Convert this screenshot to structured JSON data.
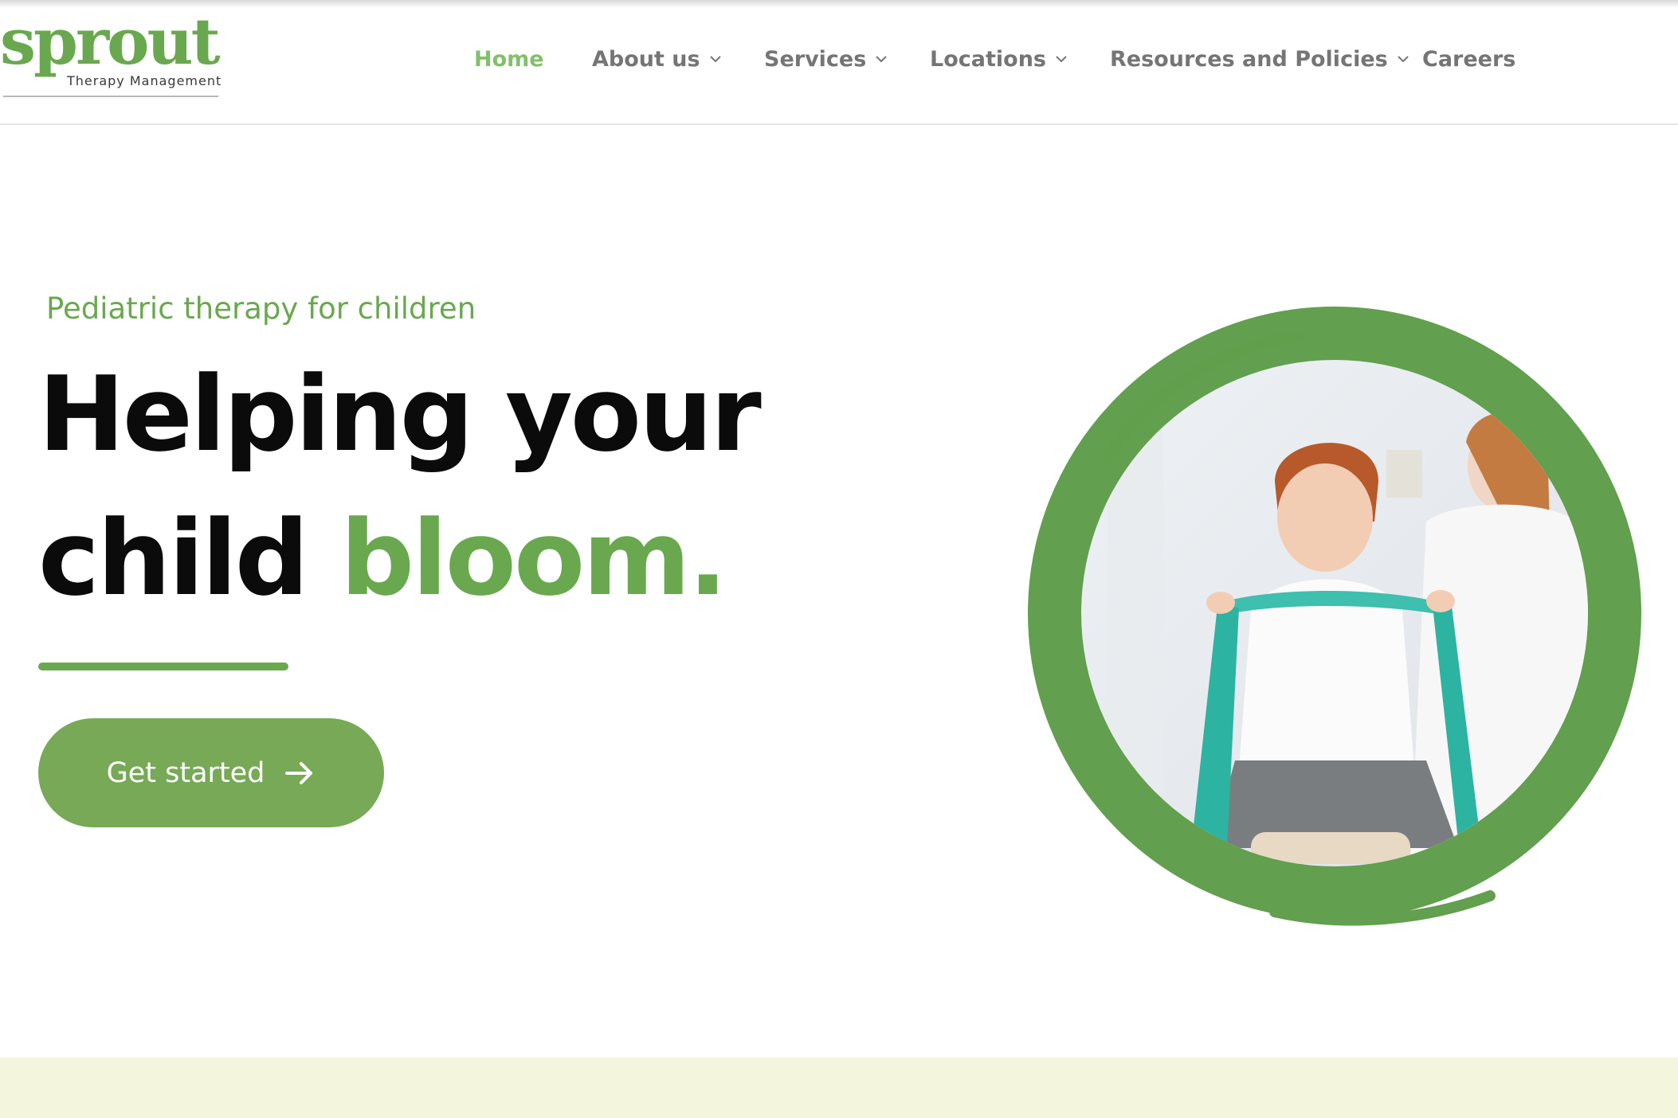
{
  "brand": {
    "name": "sprout",
    "tagline": "Therapy Management",
    "accent_color": "#6aa84f",
    "band_color": "#f4f5dd"
  },
  "nav": {
    "items": [
      {
        "label": "Home",
        "active": true,
        "dropdown": false
      },
      {
        "label": "About us",
        "active": false,
        "dropdown": true
      },
      {
        "label": "Services",
        "active": false,
        "dropdown": true
      },
      {
        "label": "Locations",
        "active": false,
        "dropdown": true
      },
      {
        "label": "Resources and Policies",
        "active": false,
        "dropdown": true
      },
      {
        "label": "Careers",
        "active": false,
        "dropdown": false
      }
    ]
  },
  "hero": {
    "eyebrow": "Pediatric therapy for children",
    "headline_line1": "Helping your",
    "headline_line2_prefix": "child",
    "headline_line2_accent": "bloom.",
    "cta_label": "Get started",
    "cta_icon": "arrow-right-icon",
    "image_alt": "Child exercising with a teal resistance band assisted by a therapist, inside a green brush-stroke circle"
  }
}
